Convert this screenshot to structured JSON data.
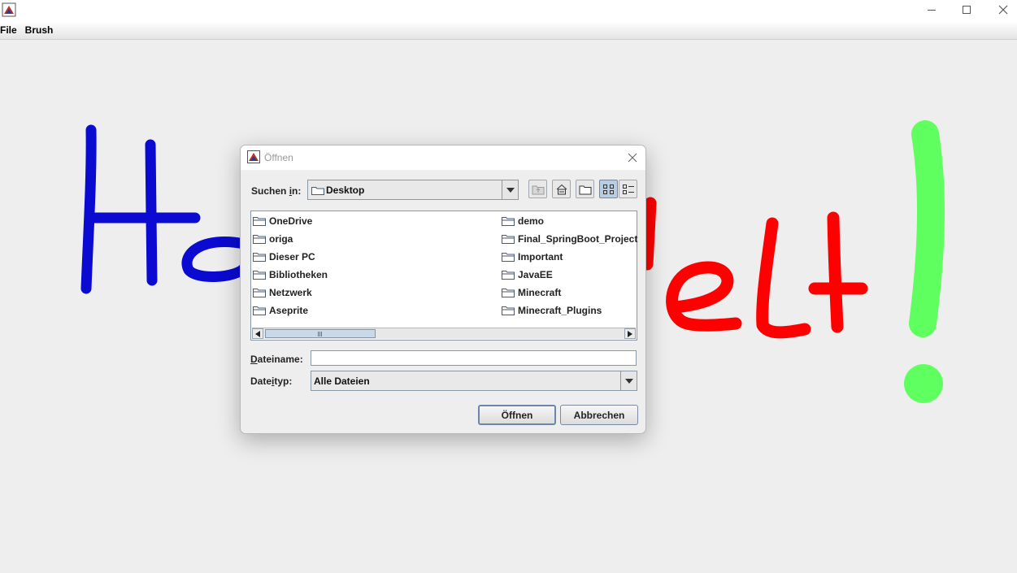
{
  "app": {
    "menu": [
      {
        "label": "File"
      },
      {
        "label": "Brush"
      }
    ]
  },
  "drawing": {
    "strokes": [
      {
        "color": "#0a0ad0",
        "desc": "blue handwritten text"
      },
      {
        "color": "#ff0000",
        "desc": "red handwritten text"
      },
      {
        "color": "#60ff60",
        "desc": "green exclamation mark"
      }
    ]
  },
  "dialog": {
    "title": "Öffnen",
    "look_in_label_pre": "Suchen ",
    "look_in_label_mnemonic": "i",
    "look_in_label_post": "n:",
    "look_in_value": "Desktop",
    "files_col1": [
      "OneDrive",
      "origa",
      "Dieser PC",
      "Bibliotheken",
      "Netzwerk",
      "Aseprite"
    ],
    "files_col2": [
      "demo",
      "Final_SpringBoot_Project",
      "Important",
      "JavaEE",
      "Minecraft",
      "Minecraft_Plugins"
    ],
    "filename_label_mnemonic": "D",
    "filename_label_rest": "ateiname:",
    "filename_value": "",
    "filetype_label_pre": "Date",
    "filetype_label_mnemonic": "i",
    "filetype_label_post": "typ:",
    "filetype_value": "Alle Dateien",
    "open_button": "Öffnen",
    "cancel_button": "Abbrechen"
  }
}
